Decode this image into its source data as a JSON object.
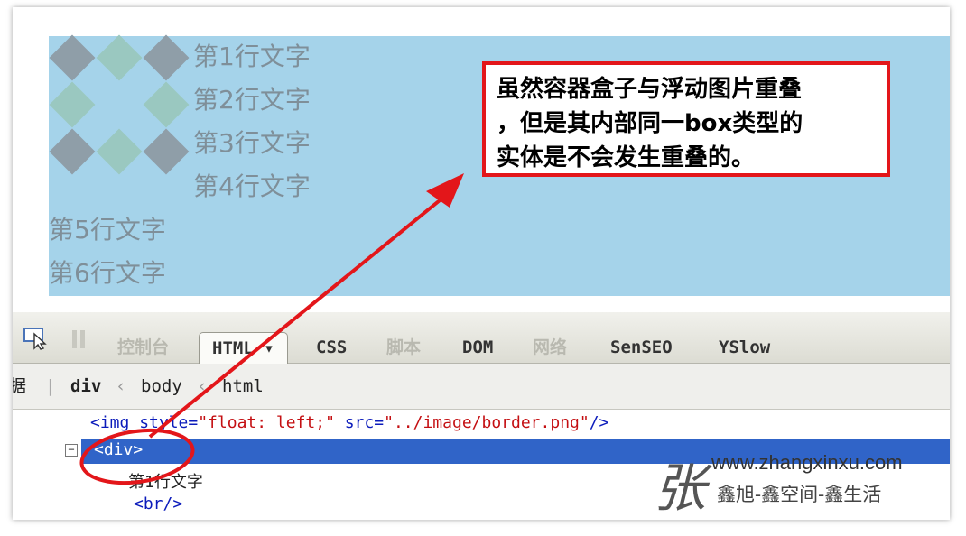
{
  "demo": {
    "lines": [
      "第1行文字",
      "第2行文字",
      "第3行文字",
      "第4行文字",
      "第5行文字",
      "第6行文字"
    ],
    "tile_colors": {
      "gray": "#8f9ea8",
      "teal": "#9ac8c0"
    }
  },
  "note": {
    "lines": [
      "虽然容器盒子与浮动图片重叠",
      "，但是其内部同一box类型的",
      "实体是不会发生重叠的。"
    ],
    "border_color": "#e3161a"
  },
  "toolbar": {
    "tabs": [
      {
        "label": "控制台",
        "state": "disabled"
      },
      {
        "label": "HTML ▾",
        "state": "active"
      },
      {
        "label": "CSS",
        "state": "normal"
      },
      {
        "label": "脚本",
        "state": "disabled"
      },
      {
        "label": "DOM",
        "state": "normal"
      },
      {
        "label": "网络",
        "state": "disabled"
      },
      {
        "label": "SenSEO",
        "state": "normal"
      },
      {
        "label": "YSlow",
        "state": "normal"
      }
    ]
  },
  "breadcrumb": {
    "prefix": "据",
    "items": [
      "div",
      "body",
      "html"
    ]
  },
  "html_panel": {
    "img_open": "<img ",
    "img_attr1": "style=",
    "img_val1": "\"float: left;\"",
    "img_attr2": " src=",
    "img_val2": "\"../image/border.png\"",
    "img_close": "/>",
    "selected": "<div>",
    "text_node": "第1行文字",
    "br": "<br/>"
  },
  "watermark": {
    "char": "张",
    "url": "www.zhangxinxu.com",
    "slogan": "鑫旭-鑫空间-鑫生活"
  }
}
